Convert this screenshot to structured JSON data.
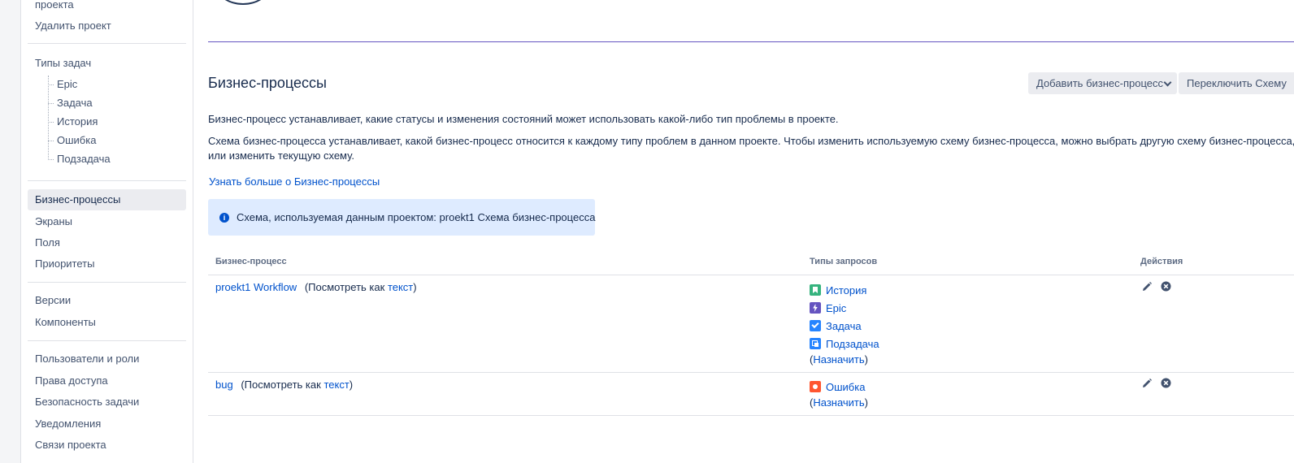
{
  "sidebar": {
    "top_partial": "проекта",
    "delete_project": "Удалить проект",
    "issue_types_heading": "Типы задач",
    "issue_types": [
      "Epic",
      "Задача",
      "История",
      "Ошибка",
      "Подзадача"
    ],
    "group1": [
      "Бизнес-процессы",
      "Экраны",
      "Поля",
      "Приоритеты"
    ],
    "group2": [
      "Версии",
      "Компоненты"
    ],
    "group3": [
      "Пользователи и роли",
      "Права доступа",
      "Безопасность задачи",
      "Уведомления",
      "Связи проекта"
    ],
    "active": "Бизнес-процессы"
  },
  "main": {
    "title": "Бизнес-процессы",
    "add_button": "Добавить бизнес-процесс",
    "switch_button": "Переключить Схему",
    "desc1": "Бизнес-процесс устанавливает, какие статусы и изменения состояний может использовать какой-либо тип проблемы в проекте.",
    "desc2": "Схема бизнес-процесса устанавливает, какой бизнес-процесс относится к каждому типу проблем в данном проекте. Чтобы изменить используемую схему бизнес-процесса, можно выбрать другую схему бизнес-процесса, или изменить текущую схему.",
    "learn_more": "Узнать больше о Бизнес-процессы",
    "info_label": "Схема, используемая данным проектом:",
    "info_value": "proekt1 Схема бизнес-процесса"
  },
  "table": {
    "headers": {
      "workflow": "Бизнес-процесс",
      "issue_types": "Типы запросов",
      "actions": "Действия"
    },
    "view_as": "(Посмотреть как",
    "view_link": "текст",
    "close_paren": ")",
    "assign_open": "(",
    "assign": "Назначить",
    "rows": [
      {
        "name": "proekt1 Workflow",
        "issue_types": [
          {
            "label": "История",
            "icon": "story-icon"
          },
          {
            "label": "Epic",
            "icon": "epic-icon"
          },
          {
            "label": "Задача",
            "icon": "task-icon"
          },
          {
            "label": "Подзадача",
            "icon": "subtask-icon"
          }
        ]
      },
      {
        "name": "bug",
        "issue_types": [
          {
            "label": "Ошибка",
            "icon": "bug-icon"
          }
        ]
      }
    ]
  },
  "colors": {
    "link": "#0052cc",
    "accent_rule": "#6554c0",
    "info_bg": "#deebff"
  }
}
